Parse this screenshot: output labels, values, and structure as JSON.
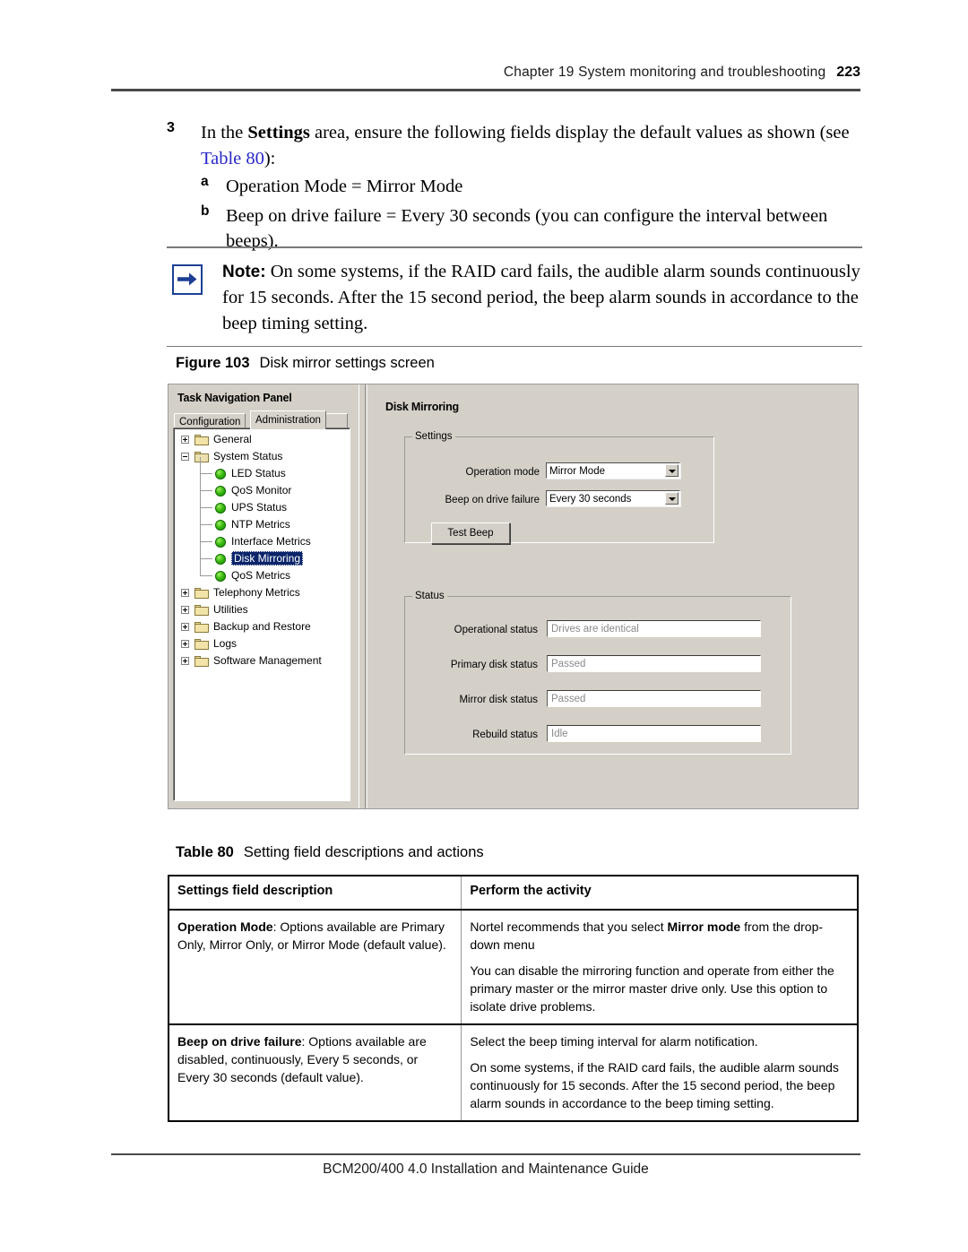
{
  "header": {
    "chapter_text": "Chapter 19  System monitoring and troubleshooting",
    "page_number": "223"
  },
  "step": {
    "number": "3",
    "text_part1": "In the ",
    "bold1": "Settings",
    "text_part2": " area, ensure the following fields display the default values as shown (see ",
    "xref": "Table 80",
    "text_part3": "):",
    "items": [
      {
        "letter": "a",
        "text": "Operation Mode = Mirror Mode"
      },
      {
        "letter": "b",
        "text": "Beep on drive failure = Every 30 seconds (you can configure the interval between beeps)."
      }
    ]
  },
  "note": {
    "icon": "right-arrow-icon",
    "label": "Note:",
    "text": " On some systems, if the RAID card fails, the audible alarm sounds continuously for 15 seconds. After the 15 second period, the beep alarm sounds in accordance to the beep timing setting."
  },
  "figure": {
    "label": "Figure 103",
    "title": "Disk mirror settings screen"
  },
  "screenshot": {
    "nav_title": "Task Navigation Panel",
    "tabs": [
      {
        "label": "Configuration",
        "active": false
      },
      {
        "label": "Administration",
        "active": true
      }
    ],
    "tree": [
      {
        "label": "General",
        "level": 0,
        "icon": "folder-closed-icon",
        "expander": "plus",
        "selected": false
      },
      {
        "label": "System Status",
        "level": 0,
        "icon": "folder-open-icon",
        "expander": "minus",
        "selected": false
      },
      {
        "label": "LED Status",
        "level": 1,
        "icon": "green-ball-icon",
        "expander": "none",
        "selected": false
      },
      {
        "label": "QoS Monitor",
        "level": 1,
        "icon": "green-ball-icon",
        "expander": "none",
        "selected": false
      },
      {
        "label": "UPS Status",
        "level": 1,
        "icon": "green-ball-icon",
        "expander": "none",
        "selected": false
      },
      {
        "label": "NTP Metrics",
        "level": 1,
        "icon": "green-ball-icon",
        "expander": "none",
        "selected": false
      },
      {
        "label": "Interface Metrics",
        "level": 1,
        "icon": "green-ball-icon",
        "expander": "none",
        "selected": false
      },
      {
        "label": "Disk Mirroring",
        "level": 1,
        "icon": "green-ball-icon",
        "expander": "none",
        "selected": true
      },
      {
        "label": "QoS Metrics",
        "level": 1,
        "icon": "green-ball-icon",
        "expander": "none",
        "selected": false
      },
      {
        "label": "Telephony Metrics",
        "level": 0,
        "icon": "folder-closed-icon",
        "expander": "plus",
        "selected": false
      },
      {
        "label": "Utilities",
        "level": 0,
        "icon": "folder-closed-icon",
        "expander": "plus",
        "selected": false
      },
      {
        "label": "Backup and Restore",
        "level": 0,
        "icon": "folder-closed-icon",
        "expander": "plus",
        "selected": false
      },
      {
        "label": "Logs",
        "level": 0,
        "icon": "folder-closed-icon",
        "expander": "plus",
        "selected": false
      },
      {
        "label": "Software Management",
        "level": 0,
        "icon": "folder-closed-icon",
        "expander": "plus",
        "selected": false
      }
    ],
    "pane_title": "Disk Mirroring",
    "settings_group": {
      "legend": "Settings",
      "operation_mode_label": "Operation mode",
      "operation_mode_value": "Mirror Mode",
      "beep_label": "Beep on drive failure",
      "beep_value": "Every 30 seconds",
      "test_beep_button": "Test Beep"
    },
    "status_group": {
      "legend": "Status",
      "rows": [
        {
          "label": "Operational status",
          "value": "Drives are identical"
        },
        {
          "label": "Primary disk status",
          "value": "Passed"
        },
        {
          "label": "Mirror disk status",
          "value": "Passed"
        },
        {
          "label": "Rebuild status",
          "value": "Idle"
        }
      ]
    },
    "colors": {
      "face": "#d4d0c8",
      "selection": "#0a246a",
      "readonly_text": "#8a8a8a"
    }
  },
  "table": {
    "label": "Table 80",
    "title": "Setting field descriptions and actions",
    "headers": [
      "Settings field description",
      "Perform the activity"
    ],
    "rows": [
      {
        "desc_bold": "Operation Mode",
        "desc_rest": ": Options available are Primary Only, Mirror Only, or Mirror Mode (default value).",
        "activity": [
          {
            "pre": "Nortel recommends that you select ",
            "bold": "Mirror mode",
            "post": " from the drop-down menu"
          },
          {
            "pre": "You can disable the mirroring function and operate from either the primary master or the mirror master drive only. Use this option to isolate drive problems.",
            "bold": "",
            "post": ""
          }
        ]
      },
      {
        "desc_bold": "Beep on drive failure",
        "desc_rest": ": Options available are disabled, continuously, Every 5 seconds, or Every 30 seconds (default value).",
        "activity": [
          {
            "pre": "Select the beep timing interval for alarm notification.",
            "bold": "",
            "post": ""
          },
          {
            "pre": "On some systems, if the RAID card fails, the audible alarm sounds continuously for 15 seconds. After the 15 second period, the beep alarm sounds in accordance to the beep timing setting.",
            "bold": "",
            "post": ""
          }
        ]
      }
    ]
  },
  "footer": {
    "text": "BCM200/400 4.0 Installation and Maintenance Guide"
  }
}
